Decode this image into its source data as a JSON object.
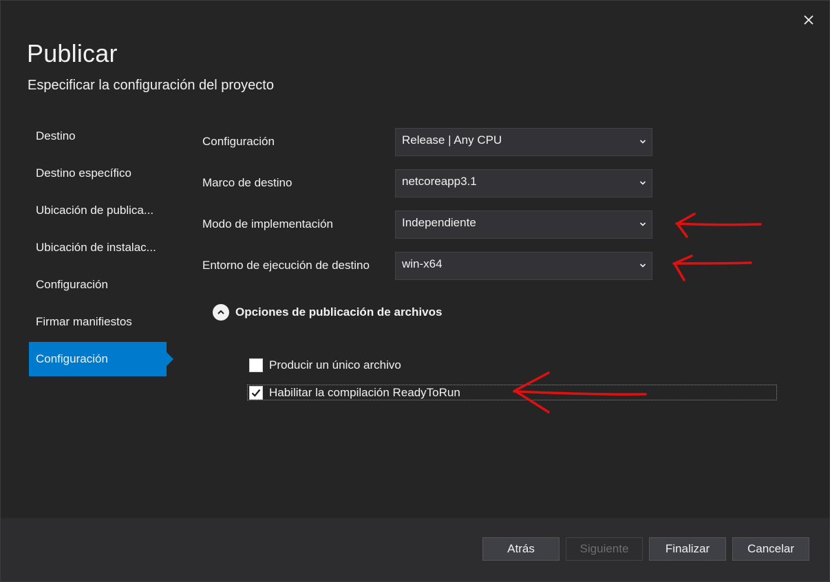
{
  "dialog": {
    "title": "Publicar",
    "subtitle": "Especificar la configuración del proyecto"
  },
  "sidebar": {
    "items": [
      {
        "label": "Destino"
      },
      {
        "label": "Destino específico"
      },
      {
        "label": "Ubicación de publica..."
      },
      {
        "label": "Ubicación de instalac..."
      },
      {
        "label": "Configuración"
      },
      {
        "label": "Firmar manifiestos"
      },
      {
        "label": "Configuración",
        "active": true
      }
    ]
  },
  "settings": {
    "configuration": {
      "label": "Configuración",
      "value": "Release | Any CPU"
    },
    "target_framework": {
      "label": "Marco de destino",
      "value": "netcoreapp3.1"
    },
    "deployment_mode": {
      "label": "Modo de implementación",
      "value": "Independiente"
    },
    "target_runtime": {
      "label": "Entorno de ejecución de destino",
      "value": "win-x64"
    }
  },
  "file_options": {
    "title": "Opciones de publicación de archivos",
    "expanded": true,
    "single_file": {
      "label": "Producir un único archivo",
      "checked": false
    },
    "ready_to_run": {
      "label": "Habilitar la compilación ReadyToRun",
      "checked": true
    }
  },
  "footer": {
    "back": "Atrás",
    "next": "Siguiente",
    "finish": "Finalizar",
    "cancel": "Cancelar"
  },
  "colors": {
    "accent": "#007acc",
    "background": "#252526",
    "annotation": "#e01010"
  },
  "icons": {
    "close": "close-icon",
    "chevron": "chevron-down-icon",
    "collapse": "chevron-up-icon",
    "check": "checkmark-icon"
  }
}
